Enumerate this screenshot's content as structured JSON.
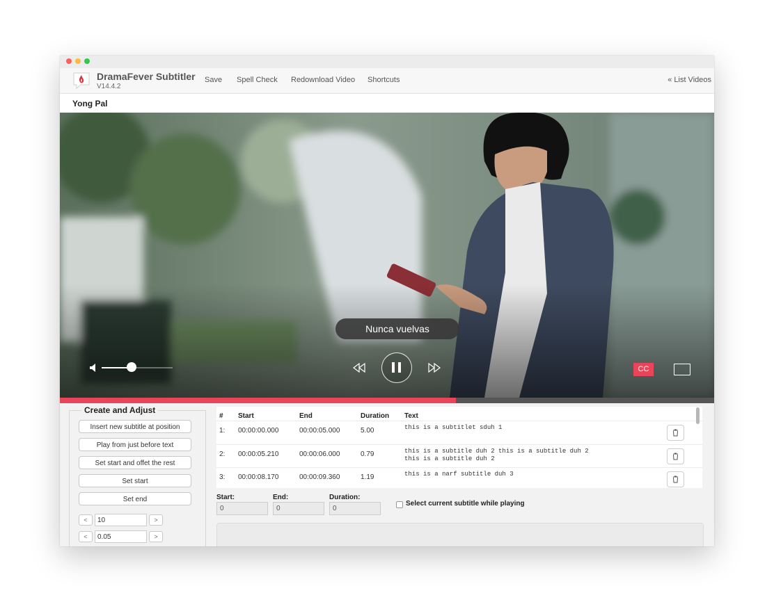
{
  "app": {
    "name": "DramaFever Subtitler",
    "version": "V14.4.2"
  },
  "toolbar": {
    "items": [
      "Save",
      "Spell Check",
      "Redownload Video",
      "Shortcuts"
    ],
    "list_videos": "« List Videos"
  },
  "show": {
    "title": "Yong Pal"
  },
  "player": {
    "caption": "Nunca vuelvas",
    "cc_label": "CC",
    "volume_fraction": 0.42,
    "progress_fraction": 0.605,
    "state": "playing",
    "colors": {
      "accent": "#e9455a"
    }
  },
  "create_adjust": {
    "title": "Create and Adjust",
    "buttons": [
      "Insert new subtitle at position",
      "Play from just before text",
      "Set start and offet the rest",
      "Set start",
      "Set end"
    ],
    "steppers": [
      {
        "dec": "<",
        "value": "10",
        "inc": ">"
      },
      {
        "dec": "<",
        "value": "0.05",
        "inc": ">"
      }
    ]
  },
  "table": {
    "headers": {
      "num": "#",
      "start": "Start",
      "end": "End",
      "duration": "Duration",
      "text": "Text"
    },
    "rows": [
      {
        "num": "1:",
        "start": "00:00:00.000",
        "end": "00:00:05.000",
        "duration": "5.00",
        "text": [
          "this is a subtitlet sduh 1"
        ]
      },
      {
        "num": "2:",
        "start": "00:00:05.210",
        "end": "00:00:06.000",
        "duration": "0.79",
        "text": [
          "this is a subtitle duh 2 this is a subtitle duh 2",
          "this is a subtitle duh 2"
        ]
      },
      {
        "num": "3:",
        "start": "00:00:08.170",
        "end": "00:00:09.360",
        "duration": "1.19",
        "text": [
          "this is a narf subtitle duh 3"
        ]
      }
    ]
  },
  "form": {
    "start_label": "Start:",
    "start_value": "0",
    "end_label": "End:",
    "end_value": "0",
    "duration_label": "Duration:",
    "duration_value": "0",
    "select_current_label": "Select current subtitle while playing"
  }
}
